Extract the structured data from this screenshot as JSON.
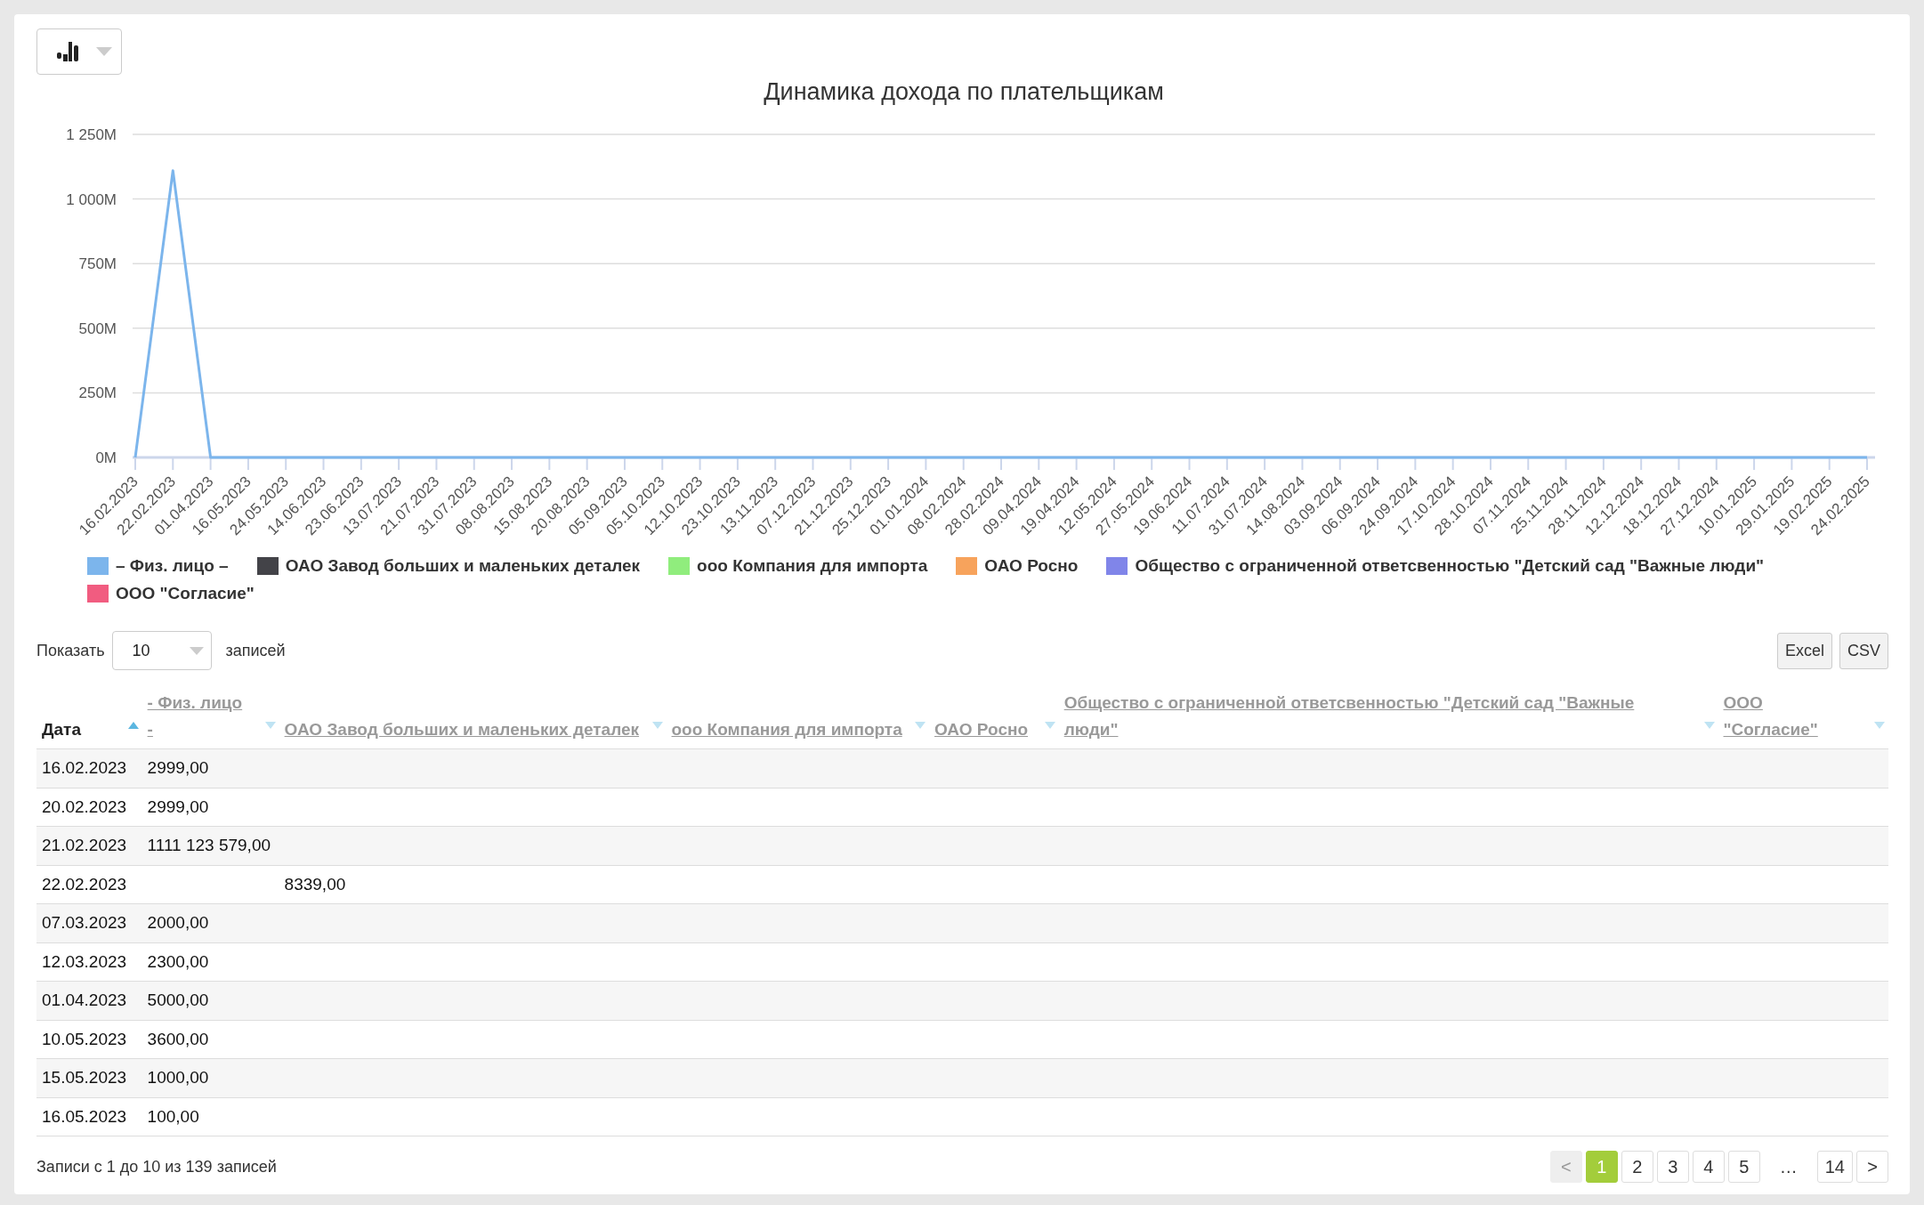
{
  "toolbar": {
    "chart_type_button": {
      "expanded": false
    }
  },
  "chart": {
    "chart_data": {
      "type": "line",
      "title": "Динамика дохода по плательщикам",
      "categories": [
        "16.02.2023",
        "22.02.2023",
        "01.04.2023",
        "16.05.2023",
        "24.05.2023",
        "14.06.2023",
        "23.06.2023",
        "13.07.2023",
        "21.07.2023",
        "31.07.2023",
        "08.08.2023",
        "15.08.2023",
        "20.08.2023",
        "05.09.2023",
        "05.10.2023",
        "12.10.2023",
        "23.10.2023",
        "13.11.2023",
        "07.12.2023",
        "21.12.2023",
        "25.12.2023",
        "01.01.2024",
        "08.02.2024",
        "28.02.2024",
        "09.04.2024",
        "19.04.2024",
        "12.05.2024",
        "27.05.2024",
        "19.06.2024",
        "11.07.2024",
        "31.07.2024",
        "14.08.2024",
        "03.09.2024",
        "06.09.2024",
        "24.09.2024",
        "17.10.2024",
        "28.10.2024",
        "07.11.2024",
        "25.11.2024",
        "28.11.2024",
        "12.12.2024",
        "18.12.2024",
        "27.12.2024",
        "10.01.2025",
        "29.01.2025",
        "19.02.2025",
        "24.02.2025"
      ],
      "grid": true,
      "ylim": [
        0,
        1250000000
      ],
      "yticks": [
        {
          "value": 0,
          "label": "0M"
        },
        {
          "value": 250000000,
          "label": "250M"
        },
        {
          "value": 500000000,
          "label": "500M"
        },
        {
          "value": 750000000,
          "label": "750M"
        },
        {
          "value": 1000000000,
          "label": "1 000M"
        },
        {
          "value": 1250000000,
          "label": "1 250M"
        }
      ],
      "series": [
        {
          "name": "– Физ. лицо –",
          "color": "#7cb5ec",
          "values": [
            0,
            1110000000,
            0,
            0,
            0,
            0,
            0,
            0,
            0,
            0,
            0,
            0,
            0,
            0,
            0,
            0,
            0,
            0,
            0,
            0,
            0,
            0,
            0,
            0,
            0,
            0,
            0,
            0,
            0,
            0,
            0,
            0,
            0,
            0,
            0,
            0,
            0,
            0,
            0,
            0,
            0,
            0,
            0,
            0,
            0,
            0,
            0
          ]
        },
        {
          "name": "ОАО Завод больших и маленьких деталек",
          "color": "#434348",
          "values": [
            null,
            null,
            null,
            null,
            null,
            null,
            null,
            null,
            null,
            null,
            null,
            null,
            null,
            null,
            null,
            null,
            null,
            null,
            null,
            null,
            null,
            null,
            null,
            null,
            null,
            null,
            null,
            null,
            null,
            null,
            null,
            null,
            null,
            null,
            null,
            null,
            null,
            null,
            null,
            null,
            null,
            null,
            null,
            null,
            null,
            null,
            null
          ]
        },
        {
          "name": "ооо Компания для импорта",
          "color": "#90ed7d",
          "values": [
            null,
            null,
            null,
            null,
            null,
            null,
            null,
            null,
            null,
            null,
            null,
            null,
            null,
            null,
            null,
            null,
            null,
            null,
            null,
            null,
            null,
            null,
            null,
            null,
            null,
            null,
            null,
            null,
            null,
            null,
            null,
            null,
            null,
            null,
            null,
            null,
            null,
            null,
            null,
            null,
            null,
            null,
            null,
            null,
            null,
            null,
            null
          ]
        },
        {
          "name": "ОАО Росно",
          "color": "#f7a35c",
          "values": [
            null,
            null,
            null,
            null,
            null,
            null,
            null,
            null,
            null,
            null,
            null,
            null,
            null,
            null,
            null,
            null,
            null,
            null,
            null,
            null,
            null,
            null,
            null,
            null,
            null,
            null,
            null,
            null,
            null,
            null,
            null,
            null,
            null,
            null,
            null,
            null,
            null,
            null,
            null,
            null,
            null,
            null,
            null,
            null,
            null,
            null,
            null
          ]
        },
        {
          "name": "Общество с ограниченной ответсвенностью \"Детский сад \"Важные люди\"",
          "color": "#8085e9",
          "values": [
            null,
            null,
            null,
            null,
            null,
            null,
            null,
            null,
            null,
            null,
            null,
            null,
            null,
            null,
            null,
            null,
            null,
            null,
            null,
            null,
            null,
            null,
            null,
            null,
            null,
            null,
            null,
            null,
            null,
            null,
            null,
            null,
            null,
            null,
            null,
            null,
            null,
            null,
            null,
            null,
            null,
            null,
            null,
            null,
            null,
            null,
            null
          ]
        },
        {
          "name": "ООО \"Согласие\"",
          "color": "#f15c80",
          "values": [
            null,
            null,
            null,
            null,
            null,
            null,
            null,
            null,
            null,
            null,
            null,
            null,
            null,
            null,
            null,
            null,
            null,
            null,
            null,
            null,
            null,
            null,
            null,
            null,
            null,
            null,
            null,
            null,
            null,
            null,
            null,
            null,
            null,
            null,
            null,
            null,
            null,
            null,
            null,
            null,
            null,
            null,
            null,
            null,
            null,
            null,
            null
          ]
        }
      ]
    }
  },
  "length_control": {
    "label_before": "Показать",
    "value": "10",
    "label_after": "записей"
  },
  "export_buttons": [
    "Excel",
    "CSV"
  ],
  "table": {
    "columns": [
      {
        "label": "Дата",
        "sorted": true
      },
      {
        "label": "- Физ. лицо -",
        "sorted": false
      },
      {
        "label": "ОАО Завод больших и маленьких деталек",
        "sorted": false
      },
      {
        "label": "ооо Компания для импорта",
        "sorted": false
      },
      {
        "label": "ОАО Росно",
        "sorted": false
      },
      {
        "label": "Общество с ограниченной ответсвенностью \"Детский сад \"Важные люди\"",
        "sorted": false
      },
      {
        "label": "ООО \"Согласие\"",
        "sorted": false
      }
    ],
    "rows": [
      [
        "16.02.2023",
        "2999,00",
        "",
        "",
        "",
        "",
        ""
      ],
      [
        "20.02.2023",
        "2999,00",
        "",
        "",
        "",
        "",
        ""
      ],
      [
        "21.02.2023",
        "1111 123 579,00",
        "",
        "",
        "",
        "",
        ""
      ],
      [
        "22.02.2023",
        "",
        "8339,00",
        "",
        "",
        "",
        ""
      ],
      [
        "07.03.2023",
        "2000,00",
        "",
        "",
        "",
        "",
        ""
      ],
      [
        "12.03.2023",
        "2300,00",
        "",
        "",
        "",
        "",
        ""
      ],
      [
        "01.04.2023",
        "5000,00",
        "",
        "",
        "",
        "",
        ""
      ],
      [
        "10.05.2023",
        "3600,00",
        "",
        "",
        "",
        "",
        ""
      ],
      [
        "15.05.2023",
        "1000,00",
        "",
        "",
        "",
        "",
        ""
      ],
      [
        "16.05.2023",
        "100,00",
        "",
        "",
        "",
        "",
        ""
      ]
    ]
  },
  "info": "Записи с 1 до 10 из 139 записей",
  "pagination": [
    {
      "label": "<",
      "kind": "button",
      "selected": false,
      "disabled": true
    },
    {
      "label": "1",
      "kind": "button",
      "selected": true,
      "disabled": false
    },
    {
      "label": "2",
      "kind": "button",
      "selected": false,
      "disabled": false
    },
    {
      "label": "3",
      "kind": "button",
      "selected": false,
      "disabled": false
    },
    {
      "label": "4",
      "kind": "button",
      "selected": false,
      "disabled": false
    },
    {
      "label": "5",
      "kind": "button",
      "selected": false,
      "disabled": false
    },
    {
      "label": "…",
      "kind": "ellipsis"
    },
    {
      "label": "14",
      "kind": "button",
      "selected": false,
      "disabled": false
    },
    {
      "label": ">",
      "kind": "button",
      "selected": false,
      "disabled": false
    }
  ]
}
